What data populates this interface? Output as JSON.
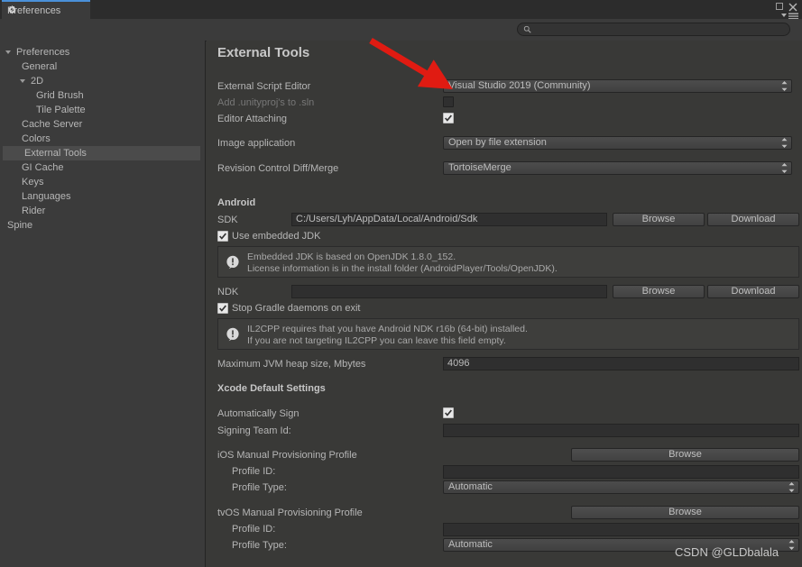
{
  "window": {
    "tab_label": "Preferences",
    "tab_icon": "gear-icon",
    "maximize_label": "□",
    "close_label": "✕",
    "menu_icon": "hamburger-menu-icon"
  },
  "search": {
    "value": "",
    "placeholder": "",
    "icon": "search-icon"
  },
  "sidebar": {
    "items": [
      {
        "label": "Preferences",
        "indent": 0,
        "arrow": "open",
        "selected": false
      },
      {
        "label": "General",
        "indent": 1,
        "arrow": "none",
        "selected": false
      },
      {
        "label": "2D",
        "indent": 1,
        "arrow": "open",
        "selected": false
      },
      {
        "label": "Grid Brush",
        "indent": 2,
        "arrow": "none",
        "selected": false
      },
      {
        "label": "Tile Palette",
        "indent": 2,
        "arrow": "none",
        "selected": false
      },
      {
        "label": "Cache Server",
        "indent": 1,
        "arrow": "none",
        "selected": false
      },
      {
        "label": "Colors",
        "indent": 1,
        "arrow": "none",
        "selected": false
      },
      {
        "label": "External Tools",
        "indent": 1,
        "arrow": "none",
        "selected": true
      },
      {
        "label": "GI Cache",
        "indent": 1,
        "arrow": "none",
        "selected": false
      },
      {
        "label": "Keys",
        "indent": 1,
        "arrow": "none",
        "selected": false
      },
      {
        "label": "Languages",
        "indent": 1,
        "arrow": "none",
        "selected": false
      },
      {
        "label": "Rider",
        "indent": 1,
        "arrow": "none",
        "selected": false
      },
      {
        "label": "Spine",
        "indent": 0,
        "arrow": "none",
        "selected": false
      }
    ]
  },
  "main": {
    "title": "External Tools",
    "external_script_editor": {
      "label": "External Script Editor",
      "value": "Visual Studio 2019 (Community)"
    },
    "add_unityproj": {
      "label": "Add .unityproj's to .sln",
      "checked": false
    },
    "editor_attaching": {
      "label": "Editor Attaching",
      "checked": true
    },
    "image_application": {
      "label": "Image application",
      "value": "Open by file extension"
    },
    "revision_control": {
      "label": "Revision Control Diff/Merge",
      "value": "TortoiseMerge"
    },
    "android": {
      "heading": "Android",
      "sdk": {
        "label": "SDK",
        "value": "C:/Users/Lyh/AppData/Local/Android/Sdk",
        "browse": "Browse",
        "download": "Download"
      },
      "use_embedded_jdk": {
        "label": "Use embedded JDK",
        "checked": true
      },
      "jdk_help": {
        "line1": "Embedded JDK is based on OpenJDK 1.8.0_152.",
        "line2": "License information is in the install folder (AndroidPlayer/Tools/OpenJDK).",
        "icon": "info-exclamation-icon"
      },
      "ndk": {
        "label": "NDK",
        "value": "",
        "browse": "Browse",
        "download": "Download"
      },
      "stop_gradle": {
        "label": "Stop Gradle daemons on exit",
        "checked": true
      },
      "ndk_help": {
        "line1": "IL2CPP requires that you have Android NDK r16b (64-bit) installed.",
        "line2": "If you are not targeting IL2CPP you can leave this field empty.",
        "icon": "info-exclamation-icon"
      },
      "jvm_heap": {
        "label": "Maximum JVM heap size, Mbytes",
        "value": "4096"
      }
    },
    "xcode": {
      "heading": "Xcode Default Settings",
      "automatically_sign": {
        "label": "Automatically Sign",
        "checked": true
      },
      "signing_team_id": {
        "label": "Signing Team Id:",
        "value": ""
      },
      "ios_profile": {
        "label": "iOS Manual Provisioning Profile",
        "browse": "Browse",
        "profile_id_label": "Profile ID:",
        "profile_id_value": "",
        "profile_type_label": "Profile Type:",
        "profile_type_value": "Automatic"
      },
      "tvos_profile": {
        "label": "tvOS Manual Provisioning Profile",
        "browse": "Browse",
        "profile_id_label": "Profile ID:",
        "profile_id_value": "",
        "profile_type_label": "Profile Type:",
        "profile_type_value": "Automatic"
      }
    }
  },
  "annotation": {
    "arrow_color": "#e01b12"
  },
  "watermark": "CSDN @GLDbalala"
}
